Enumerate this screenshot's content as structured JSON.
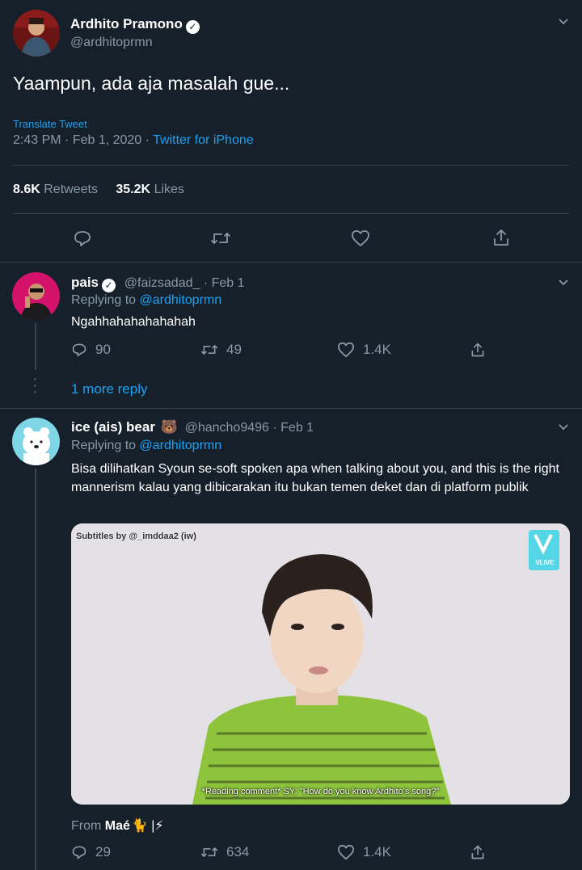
{
  "main_tweet": {
    "author_name": "Ardhito Pramono",
    "author_handle": "@ardhitoprmn",
    "text": "Yaampun, ada aja masalah gue...",
    "translate_label": "Translate Tweet",
    "timestamp": "2:43 PM · Feb 1, 2020 · ",
    "source": "Twitter for iPhone",
    "retweets_count": "8.6K",
    "retweets_label": "Retweets",
    "likes_count": "35.2K",
    "likes_label": "Likes"
  },
  "reply1": {
    "author_name": "pais",
    "handle_date": "@faizsadad_ · Feb 1",
    "replying_prefix": "Replying to ",
    "replying_to": "@ardhitoprmn",
    "text": "Ngahhahahahahahah",
    "replies": "90",
    "retweets": "49",
    "likes": "1.4K",
    "more_replies": "1 more reply"
  },
  "reply2": {
    "author_name": "ice (ais) bear",
    "author_emoji": "🐻",
    "handle_date": "@hancho9496 · Feb 1",
    "replying_prefix": "Replying to ",
    "replying_to": "@ardhitoprmn",
    "text": "Bisa dilihatkan Syoun se-soft spoken apa when talking about you, and this is the right mannerism kalau yang dibicarakan itu bukan temen deket dan di platform publik",
    "media": {
      "subtitle_credit": "Subtitles by @_imddaa2 (iw)",
      "caption": "*Reading comment* SY: \"How do you know Ardhito's song?\"",
      "logo_text": "VLIVE"
    },
    "from_prefix": "From ",
    "from_name": "Maé",
    "from_suffix": "🐈 |⚡",
    "replies": "29",
    "retweets": "634",
    "likes": "1.4K"
  },
  "colors": {
    "background": "#15202b",
    "accent": "#1da1f2",
    "secondary": "#8899a6",
    "divider": "#38444d"
  },
  "icons": [
    "reply-icon",
    "retweet-icon",
    "like-icon",
    "share-icon",
    "chevron-down-icon",
    "verified-icon"
  ]
}
